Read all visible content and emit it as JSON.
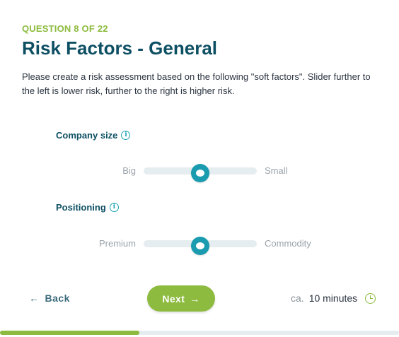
{
  "header": {
    "progress_label": "QUESTION 8 OF 22",
    "title": "Risk Factors - General",
    "description": "Please create a risk assessment based on the following \"soft factors\". Slider further to the left is lower risk, further to the right is higher risk."
  },
  "factors": [
    {
      "label": "Company size",
      "info_icon": "info-icon",
      "slider": {
        "left_label": "Big",
        "right_label": "Small",
        "value": 0.5
      }
    },
    {
      "label": "Positioning",
      "info_icon": "info-icon",
      "slider": {
        "left_label": "Premium",
        "right_label": "Commodity",
        "value": 0.5
      }
    }
  ],
  "footer": {
    "back_label": "Back",
    "back_icon": "arrow-left-icon",
    "next_label": "Next",
    "next_icon": "arrow-right-icon",
    "time_prefix": "ca.",
    "time_value": "10 minutes",
    "time_icon": "clock-icon"
  },
  "progress": {
    "fraction": 0.35
  },
  "colors": {
    "accent_green": "#8dbb3f",
    "title_teal": "#0d4f63",
    "slider_teal": "#1a9bb0",
    "track_gray": "#e6edf0"
  }
}
